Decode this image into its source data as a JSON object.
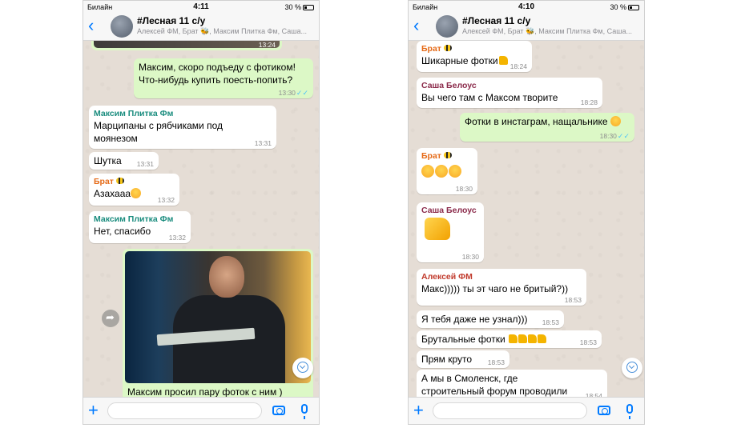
{
  "left": {
    "status": {
      "carrier": "Билайн",
      "time": "4:11",
      "battery": "30 %"
    },
    "header": {
      "back": "‹",
      "title": "#Лесная 11 с/у",
      "subtitle": "Алексей ФМ, Брат 🐝, Максим Плитка Фм, Саша..."
    },
    "top_image_time": "13:24",
    "messages": [
      {
        "text": "Максим, скоро подъеду с фотиком! Что-нибудь купить поесть-попить?",
        "time": "13:30",
        "ticks": "✓✓"
      },
      {
        "sender": "Максим Плитка Фм",
        "text": "Марципаны с рябчиками под моянезом",
        "time": "13:31"
      },
      {
        "text": "Шутка",
        "time": "13:31"
      },
      {
        "sender": "Брат",
        "text": "Азахааа",
        "time": "13:32"
      },
      {
        "sender": "Максим Плитка Фм",
        "text": "Нет, спасибо",
        "time": "13:32"
      }
    ],
    "photo_caption": "Максим просил пару фоток с ним )"
  },
  "right": {
    "status": {
      "carrier": "Билайн",
      "time": "4:10",
      "battery": "30 %"
    },
    "header": {
      "back": "‹",
      "title": "#Лесная 11 с/у",
      "subtitle": "Алексей ФМ, Брат 🐝, Максим Плитка Фм, Саша..."
    },
    "messages": [
      {
        "sender": "Брат",
        "text": "Шикарные фотки",
        "time": "18:24"
      },
      {
        "sender": "Саша Белоус",
        "text": "Вы чего там с Максом творите",
        "time": "18:28"
      },
      {
        "text": "Фотки в инстаграм, нащальнике",
        "time": "18:30",
        "ticks": "✓✓"
      },
      {
        "sender": "Брат",
        "text": "",
        "time": "18:30"
      },
      {
        "sender": "Саша Белоус",
        "text": "",
        "time": "18:30"
      },
      {
        "sender": "Алексей ФМ",
        "text": "Макс))))) ты эт чаго не бритый?))",
        "time": "18:53"
      },
      {
        "text": "Я тебя даже не узнал)))",
        "time": "18:53"
      },
      {
        "text": "Брутальные фотки",
        "time": "18:53"
      },
      {
        "text": "Прям круто",
        "time": "18:53"
      },
      {
        "text": "А мы в Смоленск, где строительный форум проводили",
        "time": "18:54"
      }
    ]
  },
  "colors": {
    "accent": "#007aff",
    "outgoing": "#dcf8c6",
    "teal_sender": "#1a8c7e",
    "orange_sender": "#e56a17",
    "maroon_sender": "#8b2a4a",
    "red_sender": "#c0392b"
  }
}
